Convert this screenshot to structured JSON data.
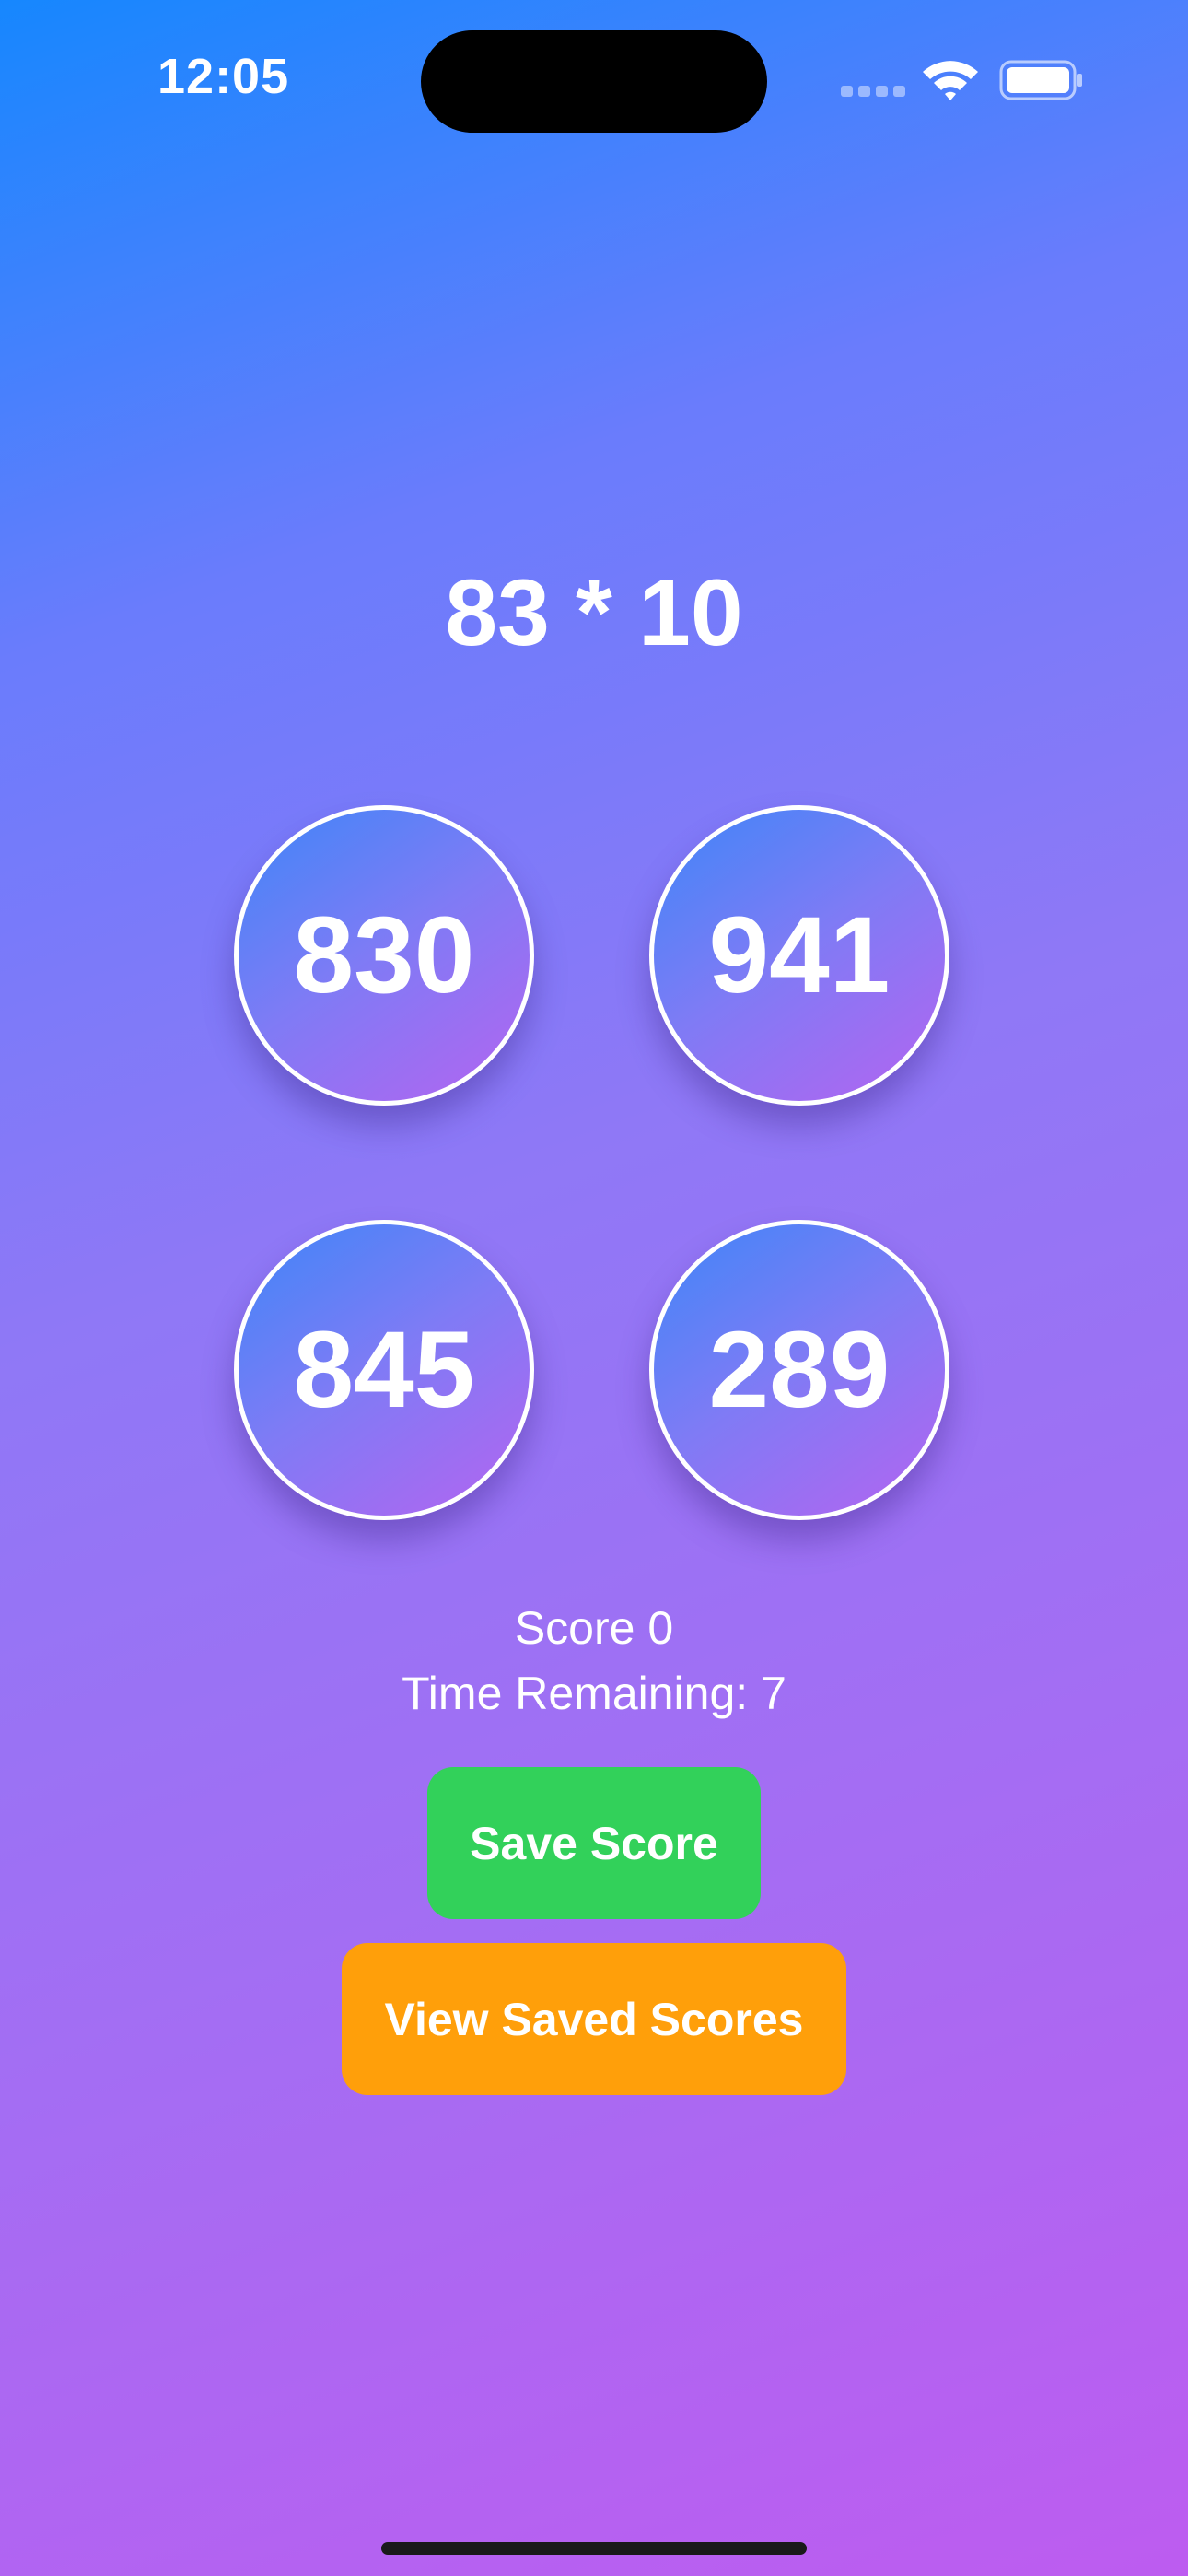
{
  "status_bar": {
    "time": "12:05",
    "icons": [
      "cellular-signal-icon",
      "wifi-icon",
      "battery-icon"
    ]
  },
  "game": {
    "question": "83 * 10",
    "answers": [
      "830",
      "941",
      "845",
      "289"
    ],
    "score_text": "Score 0",
    "timer_text": "Time Remaining: 7"
  },
  "buttons": {
    "save_label": "Save Score",
    "view_label": "View Saved Scores"
  },
  "colors": {
    "background_top": "#1687fe",
    "background_bottom": "#bd5cf0",
    "save_button": "#32d15a",
    "view_button": "#ff9f0a"
  }
}
